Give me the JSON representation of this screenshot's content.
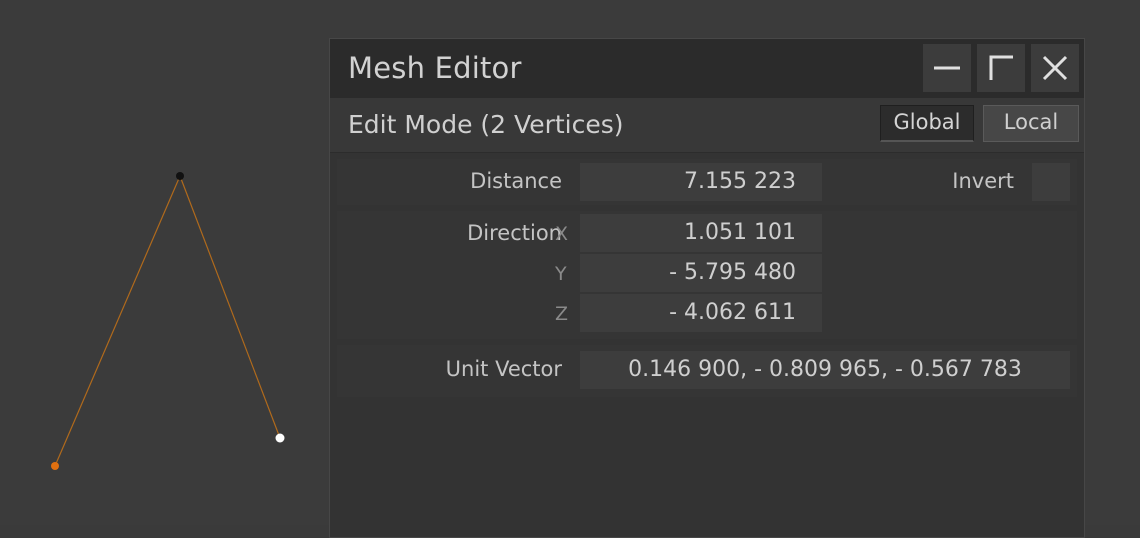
{
  "window": {
    "title": "Mesh Editor",
    "minimize_icon": "minimize-icon",
    "maximize_icon": "maximize-icon",
    "close_icon": "close-icon"
  },
  "mode": {
    "title": "Edit Mode (2 Vertices)",
    "space_options": [
      "Global",
      "Local"
    ],
    "space_selected": "Global"
  },
  "fields": {
    "distance_label": "Distance",
    "distance_value": "7.155 223",
    "invert_label": "Invert",
    "direction_label": "Direction",
    "x_label": "X",
    "x_value": "1.051 101",
    "y_label": "Y",
    "y_value": "- 5.795 480",
    "z_label": "Z",
    "z_value": "- 4.062 611",
    "unit_vector_label": "Unit Vector",
    "unit_vector_value": "0.146 900,  - 0.809 965,  - 0.567 783"
  },
  "colors": {
    "edge": "#b06a1c",
    "vertex_active": "#e07010",
    "vertex_top": "#111111",
    "vertex_selected": "#ffffff"
  }
}
